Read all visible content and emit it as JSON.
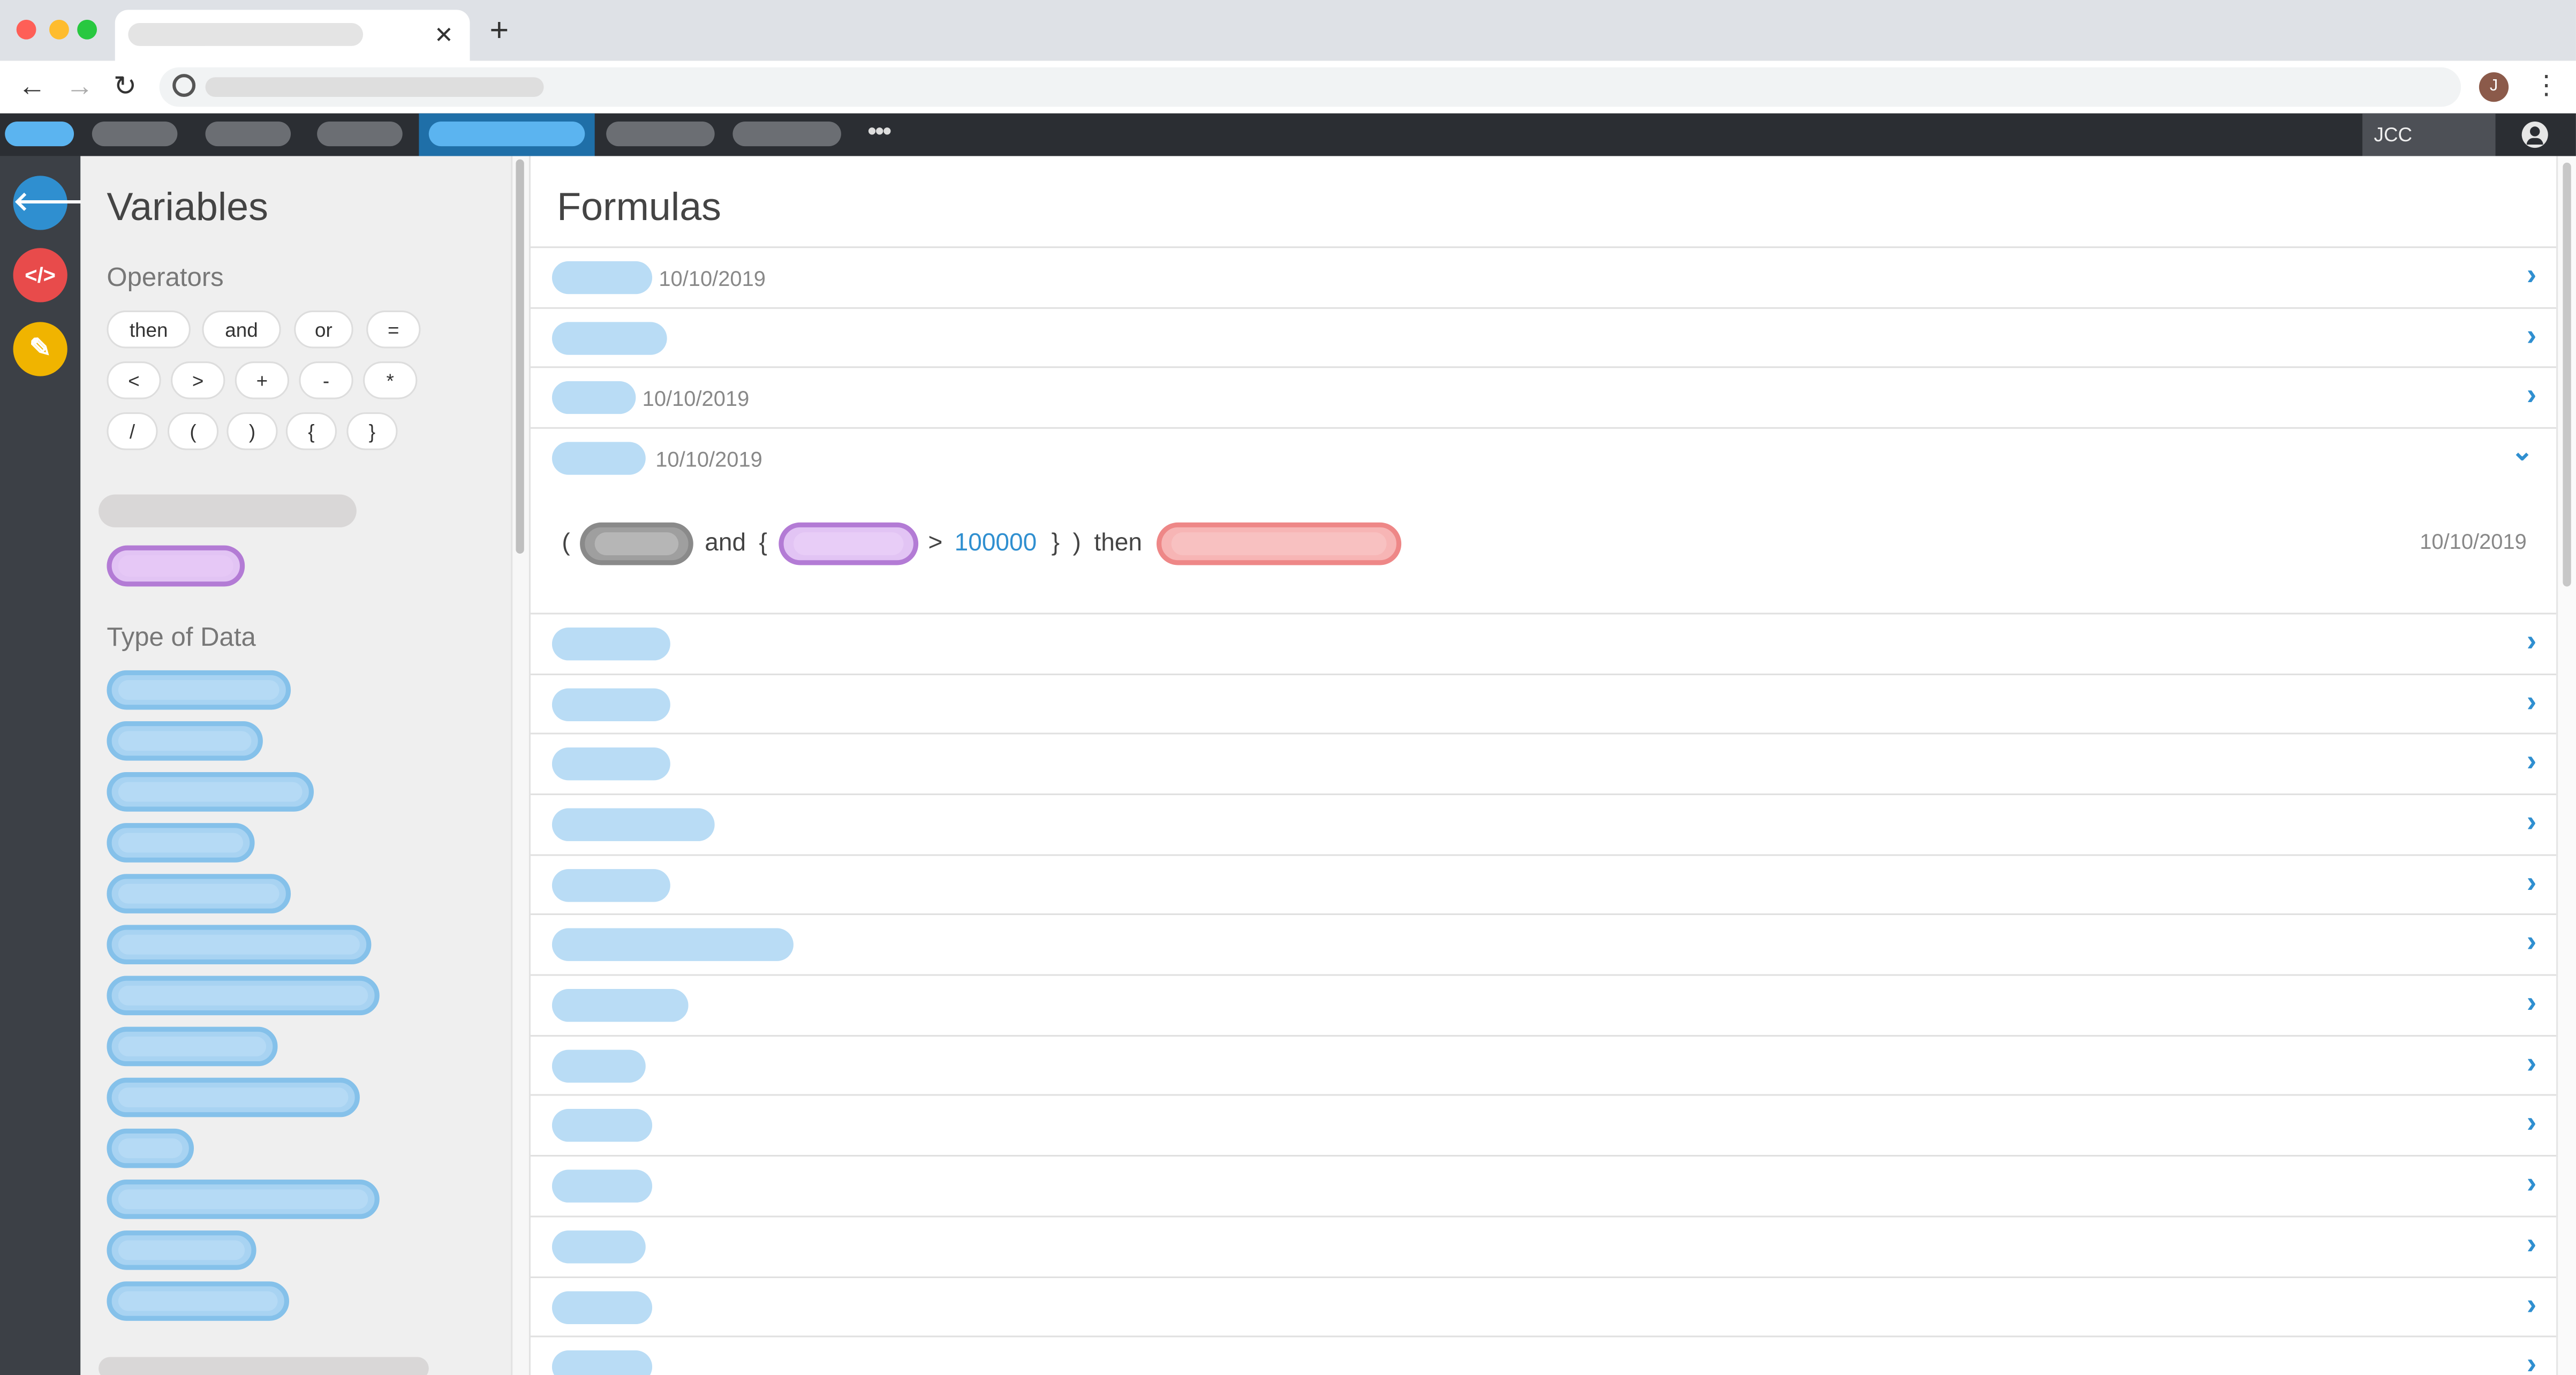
{
  "browser": {
    "tab_close": "✕",
    "new_tab": "+",
    "back": "←",
    "forward": "→",
    "reload": "↻",
    "profile_initial": "J",
    "menu": "⋮"
  },
  "app_nav": {
    "more": "•••",
    "user_label": "JCC",
    "active_color": "#1f6fa8"
  },
  "rail": {
    "back_icon": "🡐",
    "code_icon": "</>",
    "edit_icon": "✎",
    "colors": {
      "back": "#2f8fd0",
      "code": "#e84b4b",
      "edit": "#f0b400"
    }
  },
  "variables": {
    "title": "Variables",
    "operators_heading": "Operators",
    "operators": [
      "then",
      "and",
      "or",
      "=",
      "<",
      ">",
      "+",
      "-",
      "*",
      "/",
      "(",
      ")",
      "{",
      "}"
    ],
    "type_of_data_heading": "Type of Data"
  },
  "formulas": {
    "title": "Formulas",
    "rows": [
      {
        "date": "10/10/2019"
      },
      {
        "date": ""
      },
      {
        "date": "10/10/2019"
      }
    ],
    "expanded": {
      "date": "10/10/2019",
      "expression": {
        "open_paren": "(",
        "and": "and",
        "open_brace": "{",
        "gt": ">",
        "number": "100000",
        "close_brace": "}",
        "close_paren": ")",
        "then": "then"
      },
      "modified_date": "10/10/2019"
    },
    "chevron": "›",
    "chevron_down": "⌄"
  }
}
